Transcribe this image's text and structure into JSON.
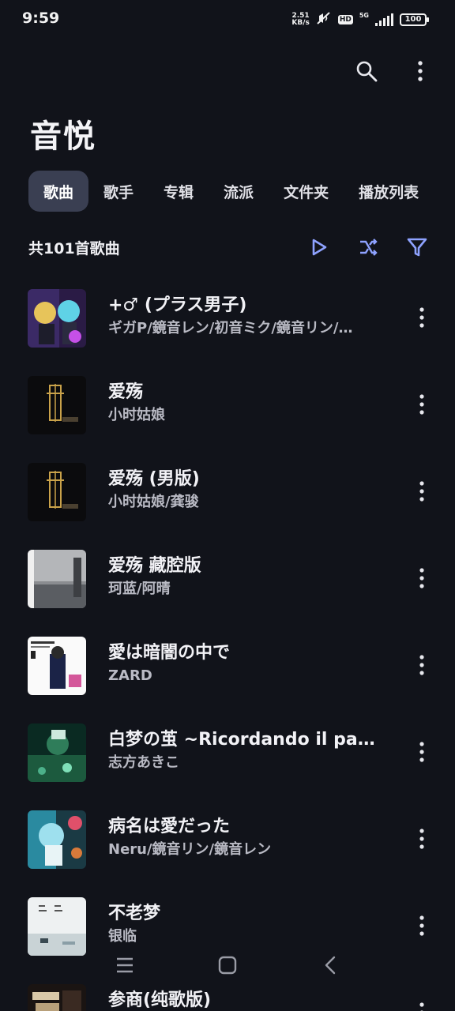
{
  "status": {
    "time": "9:59",
    "net_speed_value": "2.51",
    "net_speed_unit": "KB/s",
    "hd": "HD",
    "network": "5G",
    "battery": "100"
  },
  "app": {
    "title": "音悦"
  },
  "toolbar": {
    "search_icon": "search-icon",
    "more_icon": "more-vertical-icon"
  },
  "tabs": [
    {
      "label": "歌曲",
      "active": true
    },
    {
      "label": "歌手",
      "active": false
    },
    {
      "label": "专辑",
      "active": false
    },
    {
      "label": "流派",
      "active": false
    },
    {
      "label": "文件夹",
      "active": false
    },
    {
      "label": "播放列表",
      "active": false
    }
  ],
  "summary": {
    "count_label": "共101首歌曲",
    "play_icon": "play-icon",
    "shuffle_icon": "shuffle-icon",
    "filter_icon": "filter-icon",
    "accent_color": "#8ea2ff"
  },
  "songs": [
    {
      "title": "+♂ (プラス男子)",
      "artist": "ギガP/鏡音レン/初音ミク/鏡音リン/…"
    },
    {
      "title": "爱殇",
      "artist": "小时姑娘"
    },
    {
      "title": "爱殇 (男版)",
      "artist": "小时姑娘/龚骏"
    },
    {
      "title": "爱殇 藏腔版",
      "artist": "珂蓝/阿晴"
    },
    {
      "title": "愛は暗闇の中で",
      "artist": "ZARD"
    },
    {
      "title": "白梦の茧 ~Ricordando il pa…",
      "artist": "志方あきこ"
    },
    {
      "title": "病名は愛だった",
      "artist": "Neru/鏡音リン/鏡音レン"
    },
    {
      "title": "不老梦",
      "artist": "银临"
    },
    {
      "title": "参商(纯歌版)",
      "artist": ""
    }
  ],
  "navigation": {
    "recents_icon": "recents-icon",
    "home_icon": "home-icon",
    "back_icon": "back-icon"
  }
}
